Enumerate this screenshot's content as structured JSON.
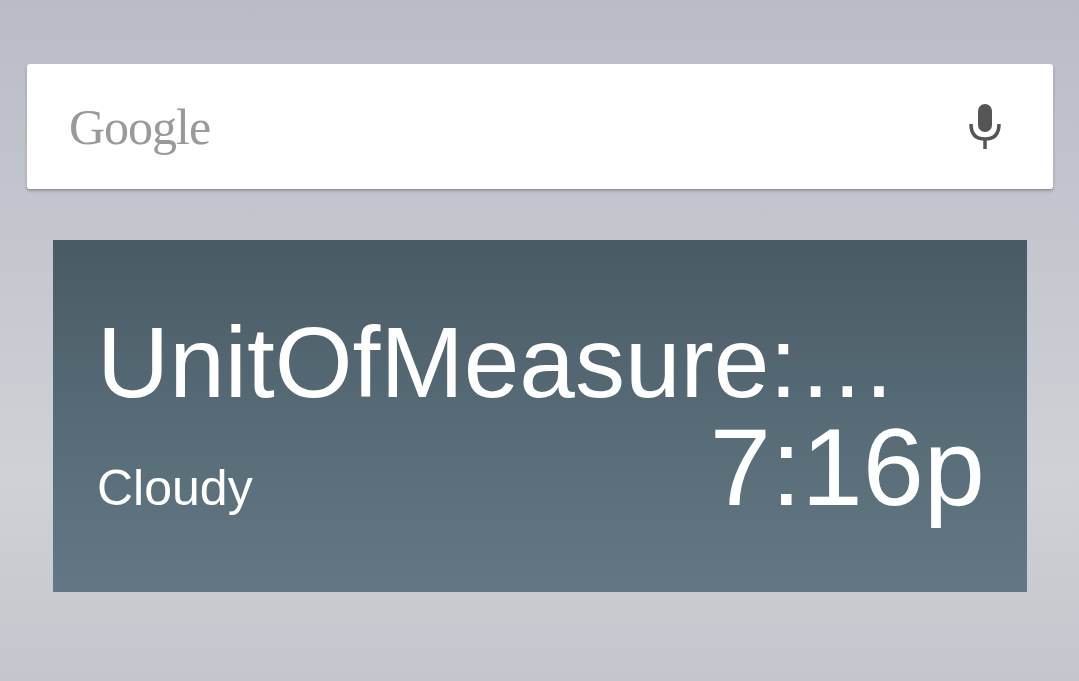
{
  "search": {
    "logo": "Google"
  },
  "widget": {
    "title": "UnitOfMeasure:…",
    "condition": "Cloudy",
    "time": "7:16p"
  }
}
